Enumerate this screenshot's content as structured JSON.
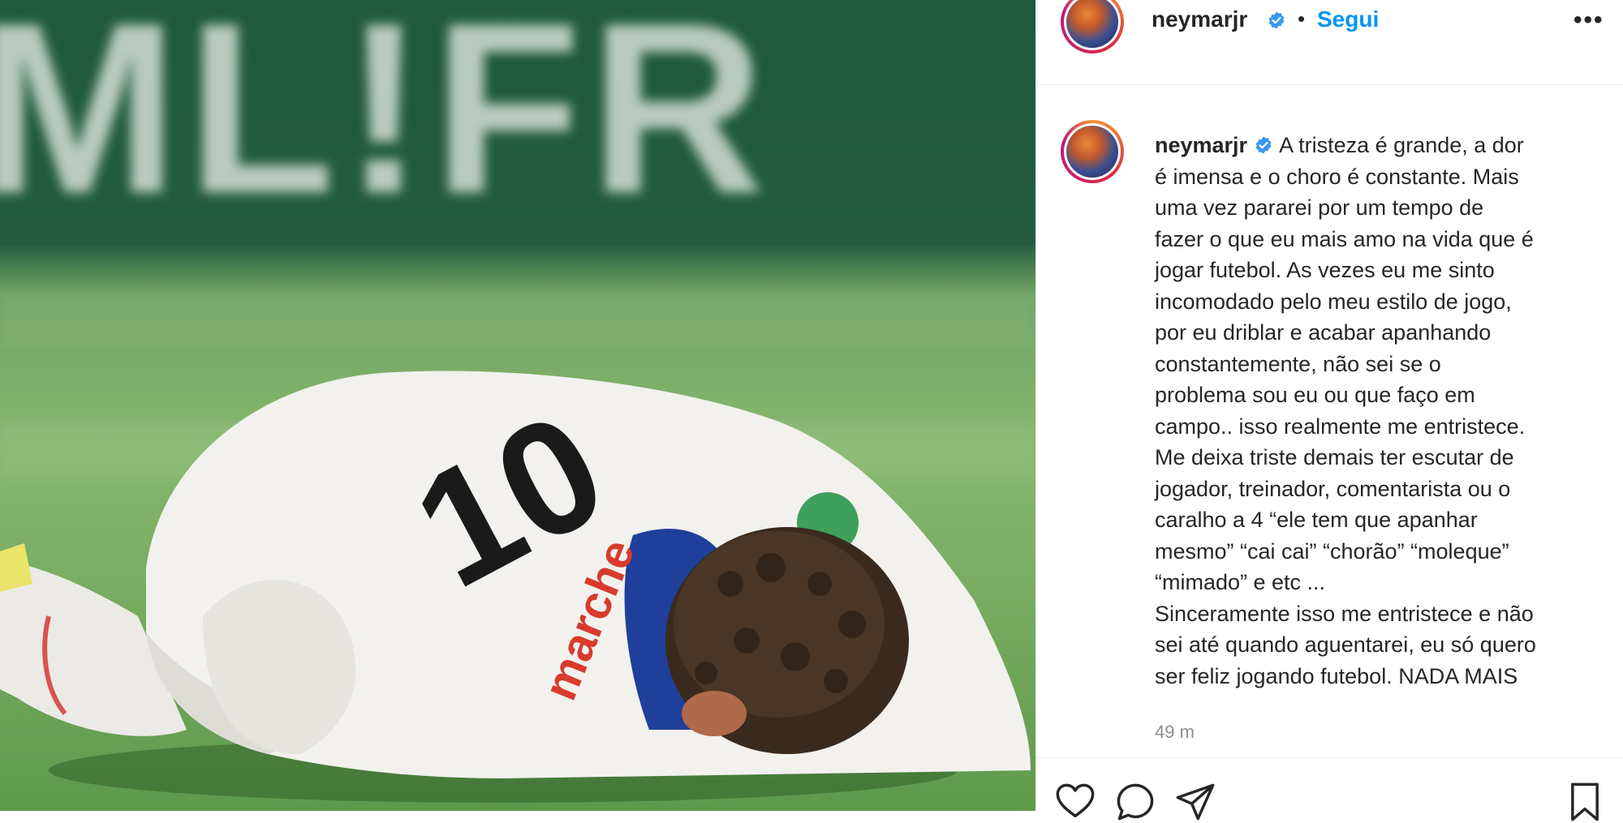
{
  "photo": {
    "banner_text": "ML!FR",
    "jersey_number": "10",
    "sponsor_text": "marche",
    "alt_description": ""
  },
  "header": {
    "username": "neymarjr",
    "separator": "•",
    "follow_label": "Segui",
    "more_label": "•••"
  },
  "caption": {
    "username": "neymarjr",
    "lines": [
      "A tristeza é grande, a dor",
      "é imensa e o choro é constante. Mais",
      "uma vez pararei por um tempo de",
      "fazer o que eu mais amo na vida que é",
      "jogar futebol. As vezes eu me sinto",
      "incomodado pelo meu estilo de jogo,",
      "por eu driblar e acabar apanhando",
      "constantemente, não sei se o",
      "problema sou eu ou que faço em",
      "campo.. isso realmente me entristece.",
      "Me deixa triste demais ter escutar de",
      "jogador, treinador, comentarista ou o",
      "caralho a 4 “ele tem que apanhar",
      "mesmo” “cai cai” “chorão” “moleque”",
      "“mimado” e etc ...",
      "Sinceramente isso me entristece e não",
      "sei até quando aguentarei, eu só quero",
      "ser feliz jogando futebol. NADA MAIS"
    ]
  },
  "timestamp": "49 m",
  "icons": {
    "like": "heart-icon",
    "comment": "comment-icon",
    "share": "paper-plane-icon",
    "save": "bookmark-icon",
    "verified": "verified-badge-icon",
    "more": "more-options-icon"
  },
  "colors": {
    "accent": "#0095f6",
    "text": "#262626",
    "muted": "#8e8e8e",
    "verified": "#3897f0"
  }
}
